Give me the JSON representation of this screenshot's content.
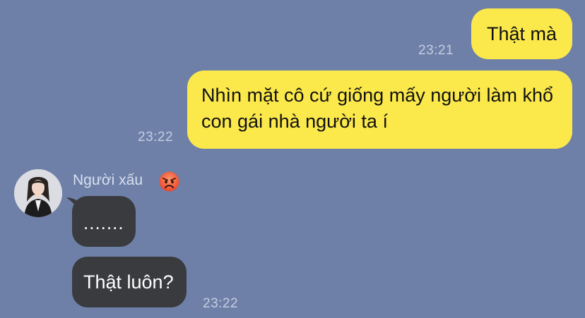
{
  "chat": {
    "messages": [
      {
        "text": "Thật mà",
        "time": "23:21"
      },
      {
        "text": "Nhìn mặt cô cứ giống mấy người làm khổ con gái nhà người ta í",
        "time": "23:22"
      },
      {
        "text": "......."
      },
      {
        "text": "Thật luôn?",
        "time": "23:22"
      }
    ],
    "sender": {
      "name": "Người xấu",
      "avatar_icon": "profile-photo",
      "emoji_icon": "angry-face-icon"
    }
  },
  "colors": {
    "background": "#6e80a8",
    "outgoing_bubble": "#fbe94c",
    "incoming_bubble": "#3a3b3f",
    "timestamp": "#c4cde0"
  }
}
